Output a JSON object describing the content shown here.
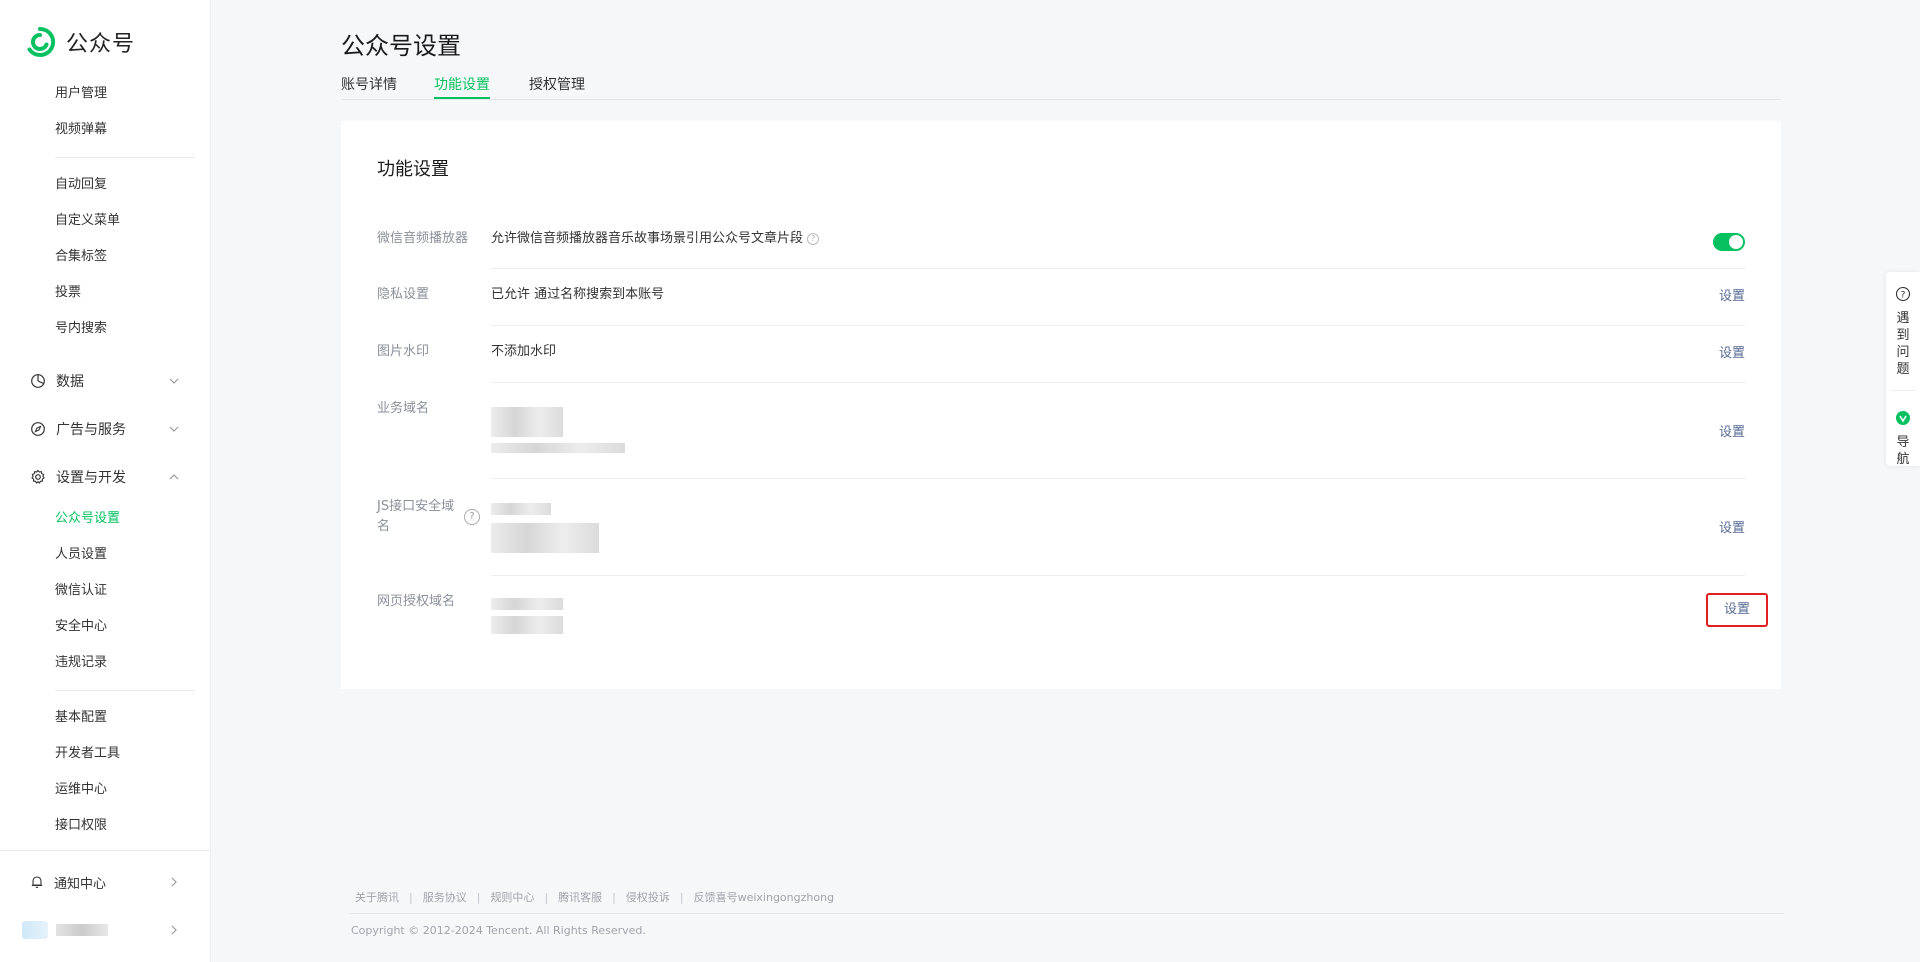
{
  "brand": {
    "name": "公众号",
    "color": "#07c160",
    "link_color": "#576b95"
  },
  "sidebar": {
    "top_items": [
      "用户管理",
      "视频弹幕"
    ],
    "items_group2": [
      "自动回复",
      "自定义菜单",
      "合集标签",
      "投票",
      "号内搜索"
    ],
    "groups": [
      {
        "label": "数据",
        "icon": "pie-chart-icon"
      },
      {
        "label": "广告与服务",
        "icon": "compass-icon"
      },
      {
        "label": "设置与开发",
        "icon": "gear-icon"
      }
    ],
    "settings_items": [
      "公众号设置",
      "人员设置",
      "微信认证",
      "安全中心",
      "违规记录"
    ],
    "dev_items": [
      "基本配置",
      "开发者工具",
      "运维中心",
      "接口权限"
    ],
    "notice": "通知中心"
  },
  "page": {
    "title": "公众号设置",
    "tabs": [
      "账号详情",
      "功能设置",
      "授权管理"
    ],
    "active_tab": "功能设置"
  },
  "card": {
    "title": "功能设置",
    "rows": {
      "player": {
        "label": "微信音频播放器",
        "value": "允许微信音频播放器音乐故事场景引用公众号文章片段",
        "enabled": true
      },
      "privacy": {
        "label": "隐私设置",
        "value": "已允许 通过名称搜索到本账号",
        "action": "设置"
      },
      "watermark": {
        "label": "图片水印",
        "value": "不添加水印",
        "action": "设置"
      },
      "business": {
        "label": "业务域名",
        "action": "设置"
      },
      "js": {
        "label": "JS接口安全域名",
        "action": "设置"
      },
      "webauth": {
        "label": "网页授权域名",
        "action": "设置"
      }
    }
  },
  "footer": {
    "links": [
      "关于腾讯",
      "服务协议",
      "规则中心",
      "腾讯客服",
      "侵权投诉",
      "反馈喜号weixingongzhong"
    ],
    "copyright": "Copyright © 2012-2024 Tencent. All Rights Reserved."
  },
  "float": {
    "help": "遇到问题",
    "nav": "导航"
  }
}
